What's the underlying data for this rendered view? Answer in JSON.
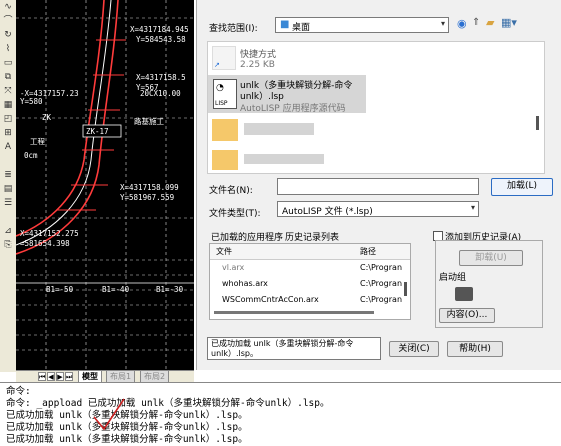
{
  "toolbar": {
    "icons": [
      "curve-icon",
      "arc-icon",
      "rotate-icon",
      "polyline-icon",
      "rectangle-icon",
      "copy-icon",
      "stretch-icon",
      "text-icon",
      "hatch-icon",
      "block-icon",
      "table-icon",
      "layer-icon"
    ]
  },
  "cad": {
    "coords": [
      "X=4317184.945",
      "Y=584543.58",
      "X=4317158.5",
      "Y=567",
      "-X=4317157.23",
      "Y=580",
      "X=4317158.099",
      "Y=581967.559",
      "X=4317152.275",
      "=581654.398"
    ],
    "labels": [
      "ZK",
      "ZK-17",
      "B1=-50",
      "B1=-40",
      "B1=-30",
      "路基施工",
      "工程",
      "0cm",
      "20CX10.00"
    ]
  },
  "tabs": {
    "model": "模型",
    "layout1": "布局1",
    "layout2": "布局2"
  },
  "dialog": {
    "lookin_label": "查找范围(I):",
    "lookin_value": "桌面",
    "files": [
      {
        "name": "快捷方式",
        "size": "2.25 KB"
      },
      {
        "name": "unlk（多重块解锁分解-命令",
        "name2": "unlk）.lsp",
        "type": "AutoLISP 应用程序源代码"
      }
    ],
    "filename_label": "文件名(N):",
    "filetype_label": "文件类型(T):",
    "filetype_value": "AutoLISP 文件 (*.lsp)",
    "load_button": "加载(L)",
    "loaded_tab": "已加载的应用程序",
    "history_tab": "历史记录列表",
    "add_history_label": "添加到历史记录(A)",
    "unload_button": "卸载(U)",
    "startup_label": "启动组",
    "contents_button": "内容(O)...",
    "col_file": "文件",
    "col_path": "路径",
    "loaded_rows": [
      {
        "file": "vl.arx",
        "path": "C:\\Progran"
      },
      {
        "file": "whohas.arx",
        "path": "C:\\Progran"
      },
      {
        "file": "WSCommCntrAcCon.arx",
        "path": "C:\\Progran"
      }
    ],
    "status_text": "已成功加载 unlk（多重块解锁分解-命令unlk）.lsp。",
    "close_button": "关闭(C)",
    "help_button": "帮助(H)"
  },
  "command": {
    "lines": [
      "命令:",
      "命令: _appload 已成功加载 unlk（多重块解锁分解-命令unlk）.lsp。",
      "已成功加载 unlk（多重块解锁分解-命令unlk）.lsp。",
      "已成功加载 unlk（多重块解锁分解-命令unlk）.lsp。",
      "已成功加载 unlk（多重块解锁分解-命令unlk）.lsp。"
    ]
  },
  "colors": {
    "cad_background": "#000000",
    "cad_grid": "#ffffff",
    "cad_dim": "#ff3b3b",
    "cad_text": "#ffffff",
    "annotation": "#cc2222"
  }
}
